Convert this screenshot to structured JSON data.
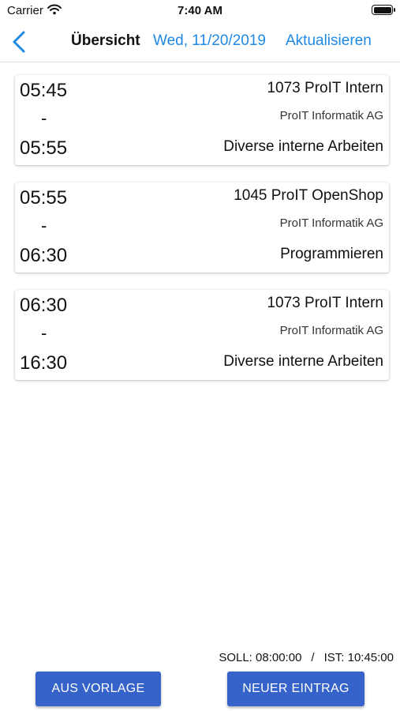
{
  "status_bar": {
    "carrier": "Carrier",
    "time": "7:40 AM"
  },
  "nav": {
    "title": "Übersicht",
    "date": "Wed, 11/20/2019",
    "refresh_label": "Aktualisieren"
  },
  "entries": [
    {
      "start": "05:45",
      "separator": "-",
      "end": "05:55",
      "project": "1073 ProIT Intern",
      "company": "ProIT Informatik AG",
      "activity": "Diverse interne Arbeiten"
    },
    {
      "start": "05:55",
      "separator": "-",
      "end": "06:30",
      "project": "1045 ProIT OpenShop",
      "company": "ProIT Informatik AG",
      "activity": "Programmieren"
    },
    {
      "start": "06:30",
      "separator": "-",
      "end": "16:30",
      "project": "1073 ProIT Intern",
      "company": "ProIT Informatik AG",
      "activity": "Diverse interne Arbeiten"
    }
  ],
  "summary": {
    "soll": "SOLL: 08:00:00",
    "separator": "/",
    "ist": "IST: 10:45:00"
  },
  "buttons": {
    "from_template": "AUS VORLAGE",
    "new_entry": "NEUER EINTRAG"
  },
  "colors": {
    "accent": "#1e88e5",
    "button": "#3563c9"
  },
  "icons": {
    "back": "chevron-left-icon",
    "wifi": "wifi-icon",
    "battery": "battery-icon"
  }
}
